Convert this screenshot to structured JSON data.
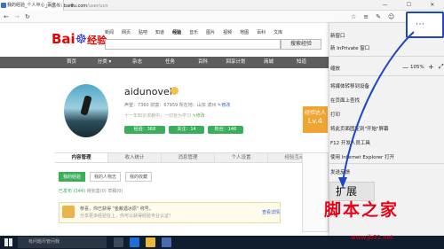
{
  "browser": {
    "tab_title": "我的经验_个人中心_百度",
    "new_tab": "+",
    "window_controls": [
      "—",
      "☐",
      "✕"
    ],
    "nav": {
      "back": "←",
      "forward": "→",
      "refresh": "↻"
    },
    "url_prefix": "jingyan.",
    "url_domain": "baidu.com",
    "url_path": "/user/ucn",
    "toolbar_icons": [
      "☆",
      "≡",
      "✎",
      "☺",
      "…"
    ]
  },
  "site": {
    "logo_text": "Bai",
    "logo_paw": "☸",
    "logo_suffix": "经验",
    "top_nav": [
      "新闻",
      "网页",
      "贴吧",
      "知道",
      "经验",
      "音乐",
      "图片",
      "视频",
      "地图",
      "百科",
      "文库"
    ],
    "top_nav_active": "经验",
    "search_button": "搜索经验",
    "dark_nav": [
      "首页",
      "分类 ▾",
      "杂志",
      "任务",
      "百科",
      "回享计划",
      "商城",
      "知道"
    ]
  },
  "profile": {
    "username": "aidunovel",
    "stats": "声望：7360  财富：67959  所在地：山东 滨州",
    "stats_edit": "✎修改",
    "tagline": "十一年知识求教中，一切皆为学习",
    "tagline_edit": "✎修改",
    "pills": [
      "经验：368",
      "关注：14",
      "粉丝：146"
    ],
    "level_badge": "Lv.4",
    "level_sub": "经验达人"
  },
  "sections": {
    "tabs": [
      "内容管理",
      "收入统计",
      "消息管理",
      "个人设置",
      "经验互动"
    ],
    "active_tab": "内容管理",
    "subtabs": [
      "我的经验",
      "我的人物志",
      "我的收藏"
    ],
    "active_subtab": "我的经验",
    "counts_label": "已发布",
    "counts_value": "(344)",
    "counts_rest": "  待完善(0)  草稿(0)",
    "notice_line1": "恭喜，你已获得 \"金戴遇冰原\" 称号。",
    "notice_line2": "分享更多经验在上，你可以获得经验专业认证！",
    "notice_link": "查看详情"
  },
  "menu": {
    "items_top": [
      "新窗口",
      "新 InPrivate 窗口"
    ],
    "zoom_label": "缩放",
    "zoom_minus": "—",
    "zoom_value": "105%",
    "zoom_plus": "+",
    "zoom_full": "⤢",
    "items_mid": [
      "将媒体转移到设备",
      "在页面上查找",
      "打印",
      "将此页面固定到\"开始\"屏幕",
      "F12 开发人员工具",
      "使用 Internet Explorer 打开",
      "发送反馈"
    ],
    "extensions": "扩展",
    "more_dots": "⋯"
  },
  "taskbar": {
    "search_placeholder": "有问题尽管问我"
  },
  "watermark": {
    "line1": "脚本之家",
    "line2": "www.jb51.net"
  },
  "colors": {
    "accent_blue": "#1c48c8",
    "baidu_red": "#e10601",
    "green": "#3aae5a"
  }
}
